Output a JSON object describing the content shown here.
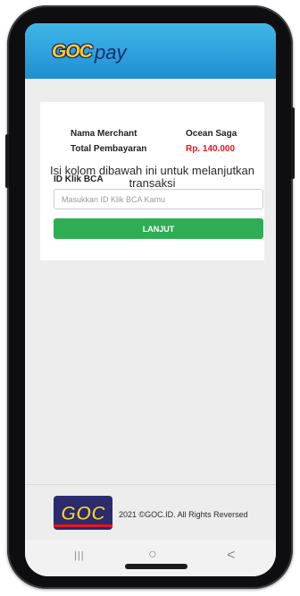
{
  "header": {
    "logo_goc": "GOC",
    "logo_pay": "pay"
  },
  "payment": {
    "merchant_label": "Nama Merchant",
    "merchant_value": "Ocean Saga",
    "total_label": "Total Pembayaran",
    "total_value": "Rp. 140.000",
    "instruction": "Isi kolom dibawah ini untuk melanjutkan transaksi",
    "field_label": "ID Klik BCA",
    "field_placeholder": "Masukkan ID Klik BCA Kamu",
    "submit_label": "LANJUT"
  },
  "footer": {
    "logo_text": "GOC",
    "copyright": "2021 ©GOC.ID. All Rights Reversed"
  },
  "navbar": {
    "recents": "|||",
    "home": "○",
    "back": "<"
  },
  "colors": {
    "header": "#2a9fdc",
    "button": "#2ead55",
    "total": "#e4161d",
    "logo": "#f6d21a"
  }
}
